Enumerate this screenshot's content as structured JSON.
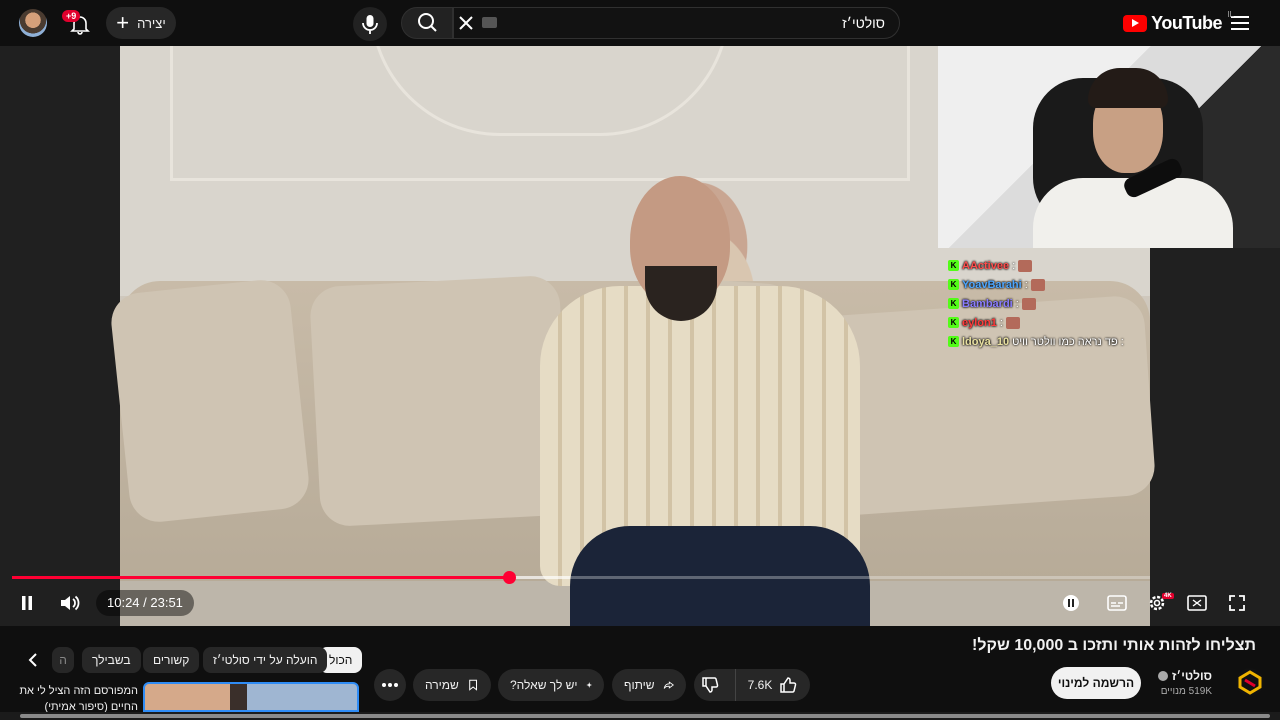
{
  "header": {
    "logo_text": "YouTube",
    "country_code": "IL",
    "search_value": "סולטי׳ז",
    "create_label": "יצירה",
    "notifications_badge": "+9"
  },
  "player": {
    "current_time": "10:24",
    "duration": "23:51",
    "time_display": "10:24 / 23:51",
    "progress_fraction": 0.4367,
    "buffered_fraction": 0.49,
    "quality_badge": "4K",
    "chat": [
      {
        "user": "AActivee",
        "color": "#ff4d4d",
        "message": ":"
      },
      {
        "user": "YoavBarahi",
        "color": "#4da6ff",
        "message": ":"
      },
      {
        "user": "Bambardi",
        "color": "#8a7dff",
        "message": ":"
      },
      {
        "user": "eylon1",
        "color": "#ff3b3b",
        "message": ":"
      },
      {
        "user": "ldoya_10",
        "color": "#e8e0a0",
        "message": ": פד נראה כמו וולטר וויט"
      }
    ]
  },
  "video": {
    "title": "תצליחו לזהות אותי ותזכו ב 10,000 שקל!",
    "channel_name": "סולטי׳ז",
    "subscribers": "519K מנויים",
    "subscribe_label": "הרשמה למינוי",
    "like_count": "7.6K",
    "share_label": "שיתוף",
    "ask_label": "יש לך שאלה?",
    "save_label": "שמירה"
  },
  "chips": [
    {
      "label": "הכול",
      "active": true
    },
    {
      "label": "הועלה על ידי סולטי׳ז",
      "active": false
    },
    {
      "label": "קשורים",
      "active": false
    },
    {
      "label": "בשבילך",
      "active": false
    },
    {
      "label": "ה",
      "active": false
    }
  ],
  "recommendation": {
    "title": "המפורסם הזה הציל לי את החיים (סיפור אמיתי)"
  },
  "colors": {
    "accent_red": "#ff0033",
    "kick_green": "#53fc18",
    "background": "#0f0f0f"
  }
}
